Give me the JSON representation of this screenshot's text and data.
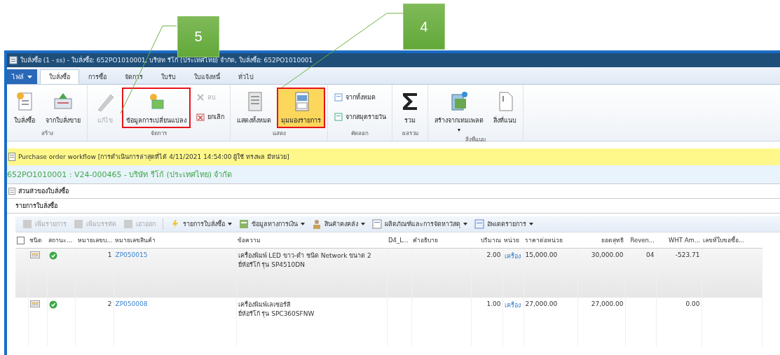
{
  "callouts": [
    {
      "number": "5"
    },
    {
      "number": "4"
    }
  ],
  "window": {
    "title": "ใบสั่งซื้อ (1 - ss) - ใบสั่งซื้อ: 652PO1010001, บริษัท รีโก้ (ประเทศไทย) จำกัด, ใบสั่งซื้อ: 652PO1010001"
  },
  "file_tab": {
    "label": "ไฟล์"
  },
  "tabs": [
    {
      "label": "ใบสั่งซื้อ",
      "selected": true
    },
    {
      "label": "การซื้อ",
      "selected": false
    },
    {
      "label": "จัดการ",
      "selected": false
    },
    {
      "label": "ใบรับ",
      "selected": false
    },
    {
      "label": "ใบแจ้งหนี้",
      "selected": false
    },
    {
      "label": "ทั่วไป",
      "selected": false
    }
  ],
  "ribbon": {
    "groups": [
      {
        "label": "สร้าง",
        "buttons": [
          {
            "kind": "large",
            "label": "ใบสั่งซื้อ",
            "disabled": false,
            "active": false,
            "annotated": false
          },
          {
            "kind": "large",
            "label": "จากใบสั่งขาย",
            "disabled": false,
            "active": false,
            "annotated": false
          }
        ]
      },
      {
        "label": "จัดการ",
        "buttons": [
          {
            "kind": "large",
            "label": "แก้ไข",
            "disabled": true,
            "active": false,
            "annotated": false
          },
          {
            "kind": "large",
            "label": "ข้อมูลการเปลี่ยนแปลง",
            "disabled": false,
            "active": false,
            "annotated": true
          },
          {
            "kind": "small",
            "label": "ลบ",
            "disabled": true,
            "active": false,
            "annotated": false
          },
          {
            "kind": "small",
            "label": "ยกเลิก",
            "disabled": false,
            "active": false,
            "annotated": false
          }
        ]
      },
      {
        "label": "แสดง",
        "buttons": [
          {
            "kind": "large",
            "label": "แสดงทั้งหมด",
            "disabled": false,
            "active": false,
            "annotated": false
          },
          {
            "kind": "large",
            "label": "มุมมองรายการ",
            "disabled": false,
            "active": true,
            "annotated": true
          }
        ]
      },
      {
        "label": "คัดลอก",
        "buttons": [
          {
            "kind": "small",
            "label": "จากทั้งหมด",
            "disabled": false,
            "active": false,
            "annotated": false
          },
          {
            "kind": "small",
            "label": "จากสมุดรายวัน",
            "disabled": false,
            "active": false,
            "annotated": false
          }
        ]
      },
      {
        "label": "ผลรวม",
        "buttons": [
          {
            "kind": "large",
            "label": "รวม",
            "disabled": false,
            "active": false,
            "annotated": false
          }
        ]
      },
      {
        "label": "สิ่งที่แนบ",
        "buttons": [
          {
            "kind": "large",
            "label": "สร้างจากเทมเพลต",
            "disabled": false,
            "active": false,
            "annotated": false,
            "dropdown": "▾"
          },
          {
            "kind": "large",
            "label": "สิ่งที่แนบ",
            "disabled": false,
            "active": false,
            "annotated": false
          }
        ]
      }
    ]
  },
  "workflow_bar": {
    "text": "Purchase order workflow [การดำเนินการล่าสุดที่ได้ 4/11/2021 14:54:00 ผู้ใช้ ทรงพล มีหน่วย]"
  },
  "order_header": "652PO1010001 : V24-000465 - บริษัท รีโก้ (ประเทศไทย) จำกัด",
  "sections": [
    {
      "label": "ส่วนหัวของใบสั่งซื้อ",
      "expanded": false
    },
    {
      "label": "รายการใบสั่งซื้อ",
      "expanded": true
    }
  ],
  "line_toolbar": [
    {
      "label": "เพิ่มรายการ",
      "disabled": true,
      "menu": false
    },
    {
      "label": "เพิ่มบรรทัด",
      "disabled": true,
      "menu": false
    },
    {
      "label": "เอาออก",
      "disabled": true,
      "menu": false
    },
    {
      "label": "รายการใบสั่งซื้อ",
      "disabled": false,
      "menu": true
    },
    {
      "label": "ข้อมูลทางการเงิน",
      "disabled": false,
      "menu": true
    },
    {
      "label": "สินค้าคงคลัง",
      "disabled": false,
      "menu": true
    },
    {
      "label": "ผลิตภัณฑ์และการจัดหาวัสดุ",
      "disabled": false,
      "menu": true
    },
    {
      "label": "อัพเดตรายการ",
      "disabled": false,
      "menu": true
    }
  ],
  "table": {
    "all_selected": false,
    "columns": [
      "ชนิด",
      "สถานะ...",
      "หมายเลขบ...",
      "หมายเลขสินค้า",
      "ข้อความ",
      "D4_L...",
      "คำอธิบาย",
      "ปริมาณ",
      "หน่วย",
      "ราคาต่อหน่วย",
      "ยอดสุทธิ",
      "Reven...",
      "WHT Am...",
      "เลขที่ใบขอซื้อ..."
    ],
    "rows": [
      {
        "selected": true,
        "line": "1",
        "item": "ZP050015",
        "text": [
          "เครื่องพิมพ์ LED ขาว-ดำ ชนิด Network ขนาด 2",
          "ยี่ห้อรีโก้ รุ่น SP4510DN"
        ],
        "quantity": "2.00",
        "unit": "เครื่อง",
        "unit_price": "15,000.00",
        "net_amount": "30,000.00",
        "revenue": "04",
        "wht_amount": "-523.71"
      },
      {
        "selected": false,
        "line": "2",
        "item": "ZP050008",
        "text": [
          "เครื่องพิมพ์เลเซอร์สี",
          "ยี่ห้อรีโก้ รุ่น SPC360SFNW"
        ],
        "quantity": "1.00",
        "unit": "เครื่อง",
        "unit_price": "27,000.00",
        "net_amount": "27,000.00",
        "wht_amount": "0.00"
      }
    ]
  }
}
